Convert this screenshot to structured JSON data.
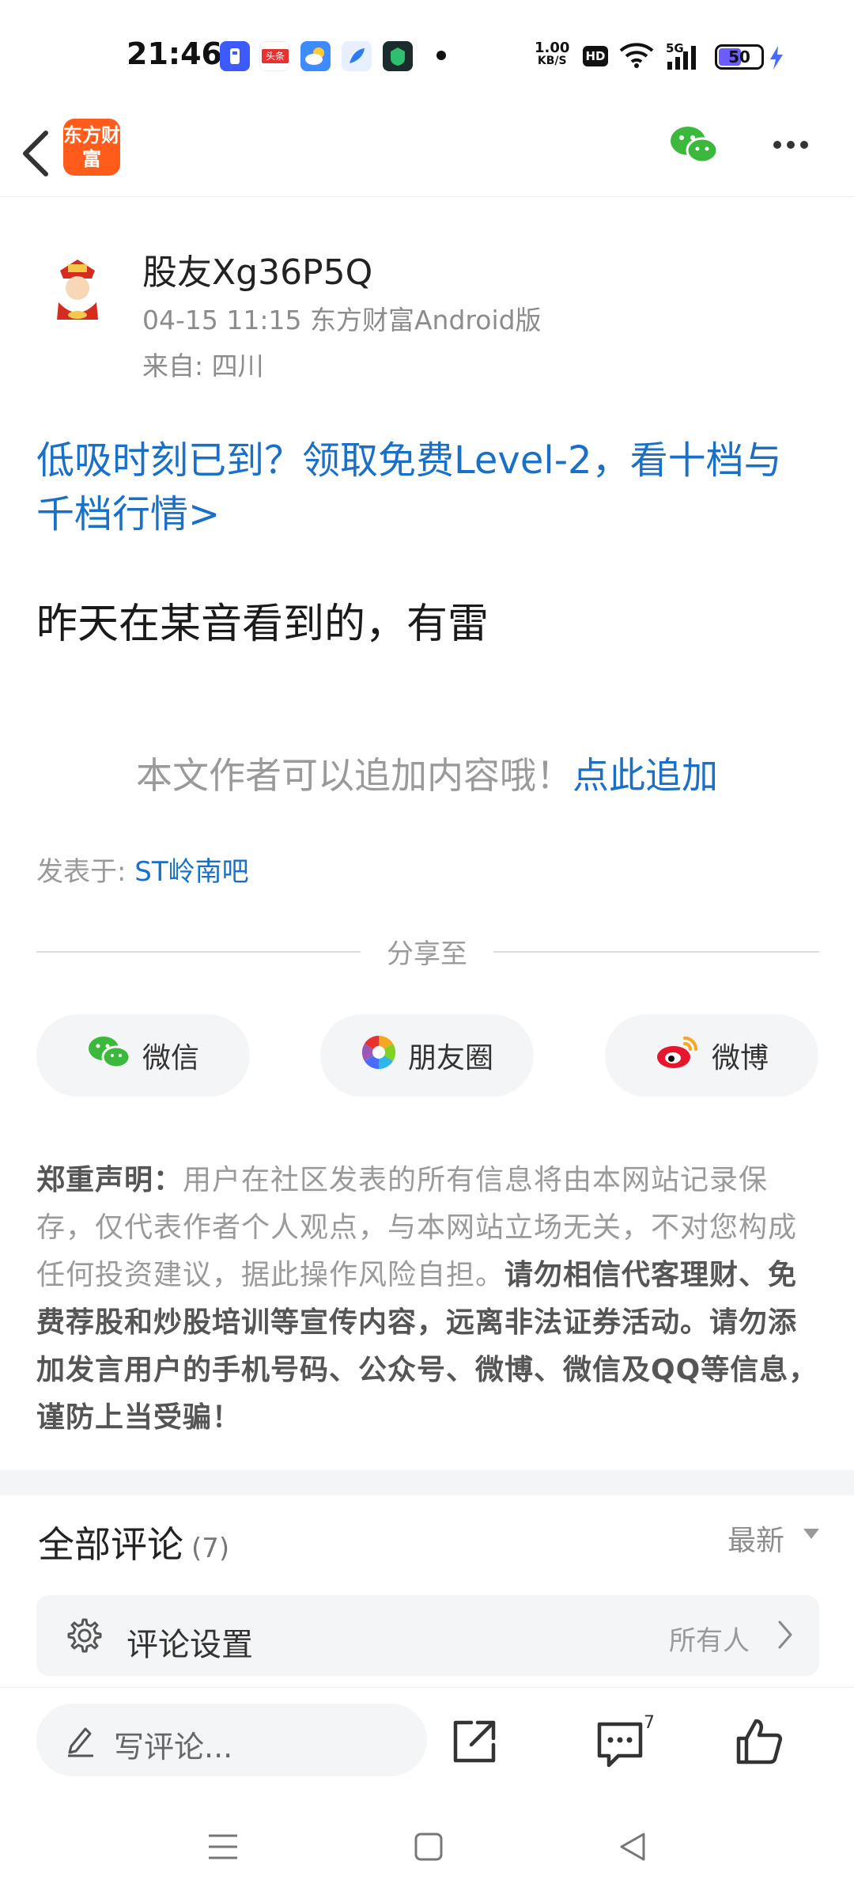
{
  "status_bar": {
    "time": "21:46",
    "net_speed_value": "1.00",
    "net_speed_unit": "KB/S",
    "hd_label": "HD",
    "signal_label": "5G",
    "battery_level": "50",
    "notification_icons": [
      "toolbox-app-icon",
      "toutiao-app-icon",
      "weather-app-icon",
      "feather-app-icon",
      "security-app-icon"
    ],
    "toutiao_label": "头条"
  },
  "header": {
    "logo_text": "东方财富"
  },
  "post": {
    "author_name": "股友Xg36P5Q",
    "meta": "04-15 11:15 东方财富Android版",
    "location": "来自: 四川",
    "promo_link": "低吸时刻已到？领取免费Level-2，看十档与千档行情>",
    "body": "昨天在某音看到的，有雷",
    "append_hint": "本文作者可以追加内容哦！",
    "append_link": "点此追加",
    "published_prefix": "发表于:",
    "published_bar": "ST岭南吧"
  },
  "share": {
    "title": "分享至",
    "wechat": "微信",
    "moments": "朋友圈",
    "weibo": "微博"
  },
  "disclaimer": {
    "label": "郑重声明：",
    "normal_text": "用户在社区发表的所有信息将由本网站记录保存，仅代表作者个人观点，与本网站立场无关，不对您构成任何投资建议，据此操作风险自担。",
    "bold_text": "请勿相信代客理财、免费荐股和炒股培训等宣传内容，远离非法证券活动。请勿添加发言用户的手机号码、公众号、微博、微信及QQ等信息，谨防上当受骗！"
  },
  "comments": {
    "title": "全部评论",
    "count": "(7)",
    "sort": "最新",
    "settings_label": "评论设置",
    "settings_value": "所有人"
  },
  "bottom_bar": {
    "input_placeholder": "写评论...",
    "comment_badge": "7"
  },
  "colors": {
    "link_blue": "#1a6fc7",
    "brand_orange": "#ff5b1a",
    "wechat_green": "#3cb93c",
    "weibo_red": "#e6162d"
  }
}
